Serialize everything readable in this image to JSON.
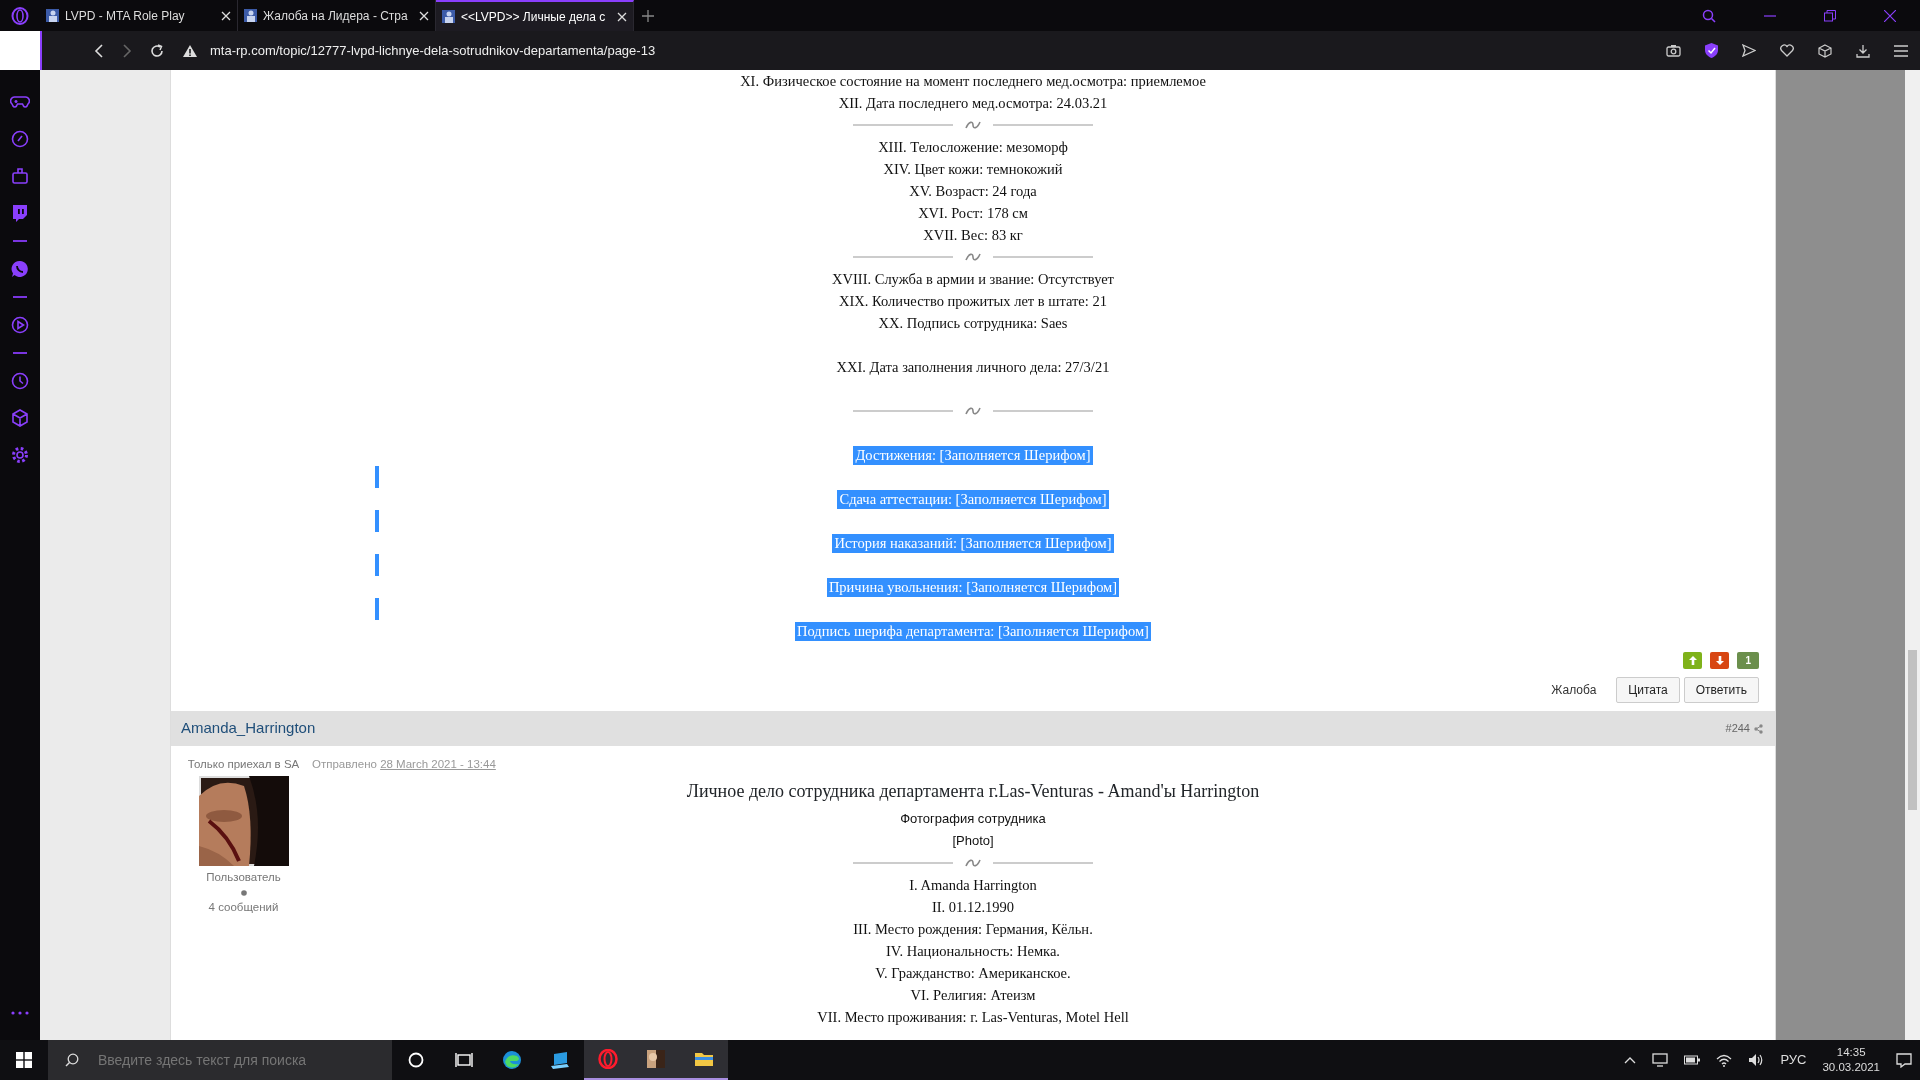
{
  "browser": {
    "tabs": [
      {
        "title": "LVPD - MTA Role Play",
        "selected": false
      },
      {
        "title": "Жалоба на Лидера - Стра",
        "selected": false
      },
      {
        "title": "<<LVPD>> Личные дела с",
        "selected": true
      }
    ],
    "url": "mta-rp.com/topic/12777-lvpd-lichnye-dela-sotrudnikov-departamenta/page-13"
  },
  "post1": {
    "lines": [
      {
        "kind": "text",
        "text": "XI. Физическое состояние на момент последнего мед.осмотра: приемлемое"
      },
      {
        "kind": "text",
        "text": "XII. Дата последнего мед.осмотра: 24.03.21"
      },
      {
        "kind": "divider"
      },
      {
        "kind": "text",
        "text": "XIII. Телосложение: мезоморф"
      },
      {
        "kind": "text",
        "text": "XIV. Цвет кожи: темнокожий"
      },
      {
        "kind": "text",
        "text": "XV. Возраст: 24 года"
      },
      {
        "kind": "text",
        "text": "XVI. Рост: 178 см"
      },
      {
        "kind": "text",
        "text": "XVII. Вес: 83 кг"
      },
      {
        "kind": "divider"
      },
      {
        "kind": "text",
        "text": "XVIII. Служба в армии и звание: Отсутствует"
      },
      {
        "kind": "text",
        "text": "XIX. Количество прожитых лет в штате: 21"
      },
      {
        "kind": "text",
        "text": "XX. Подпись сотрудника: Saes"
      },
      {
        "kind": "gap"
      },
      {
        "kind": "text",
        "text": "XXI. Дата заполнения личного дела: 27/3/21"
      },
      {
        "kind": "gap"
      },
      {
        "kind": "divider"
      },
      {
        "kind": "gap"
      },
      {
        "kind": "selected",
        "text": "Достижения: [Заполняется Шерифом]"
      },
      {
        "kind": "gap",
        "selected": true
      },
      {
        "kind": "selected",
        "text": "Сдача аттестации: [Заполняется Шерифом]"
      },
      {
        "kind": "gap",
        "selected": true
      },
      {
        "kind": "selected",
        "text": "История наказаний: [Заполняется Шерифом]"
      },
      {
        "kind": "gap",
        "selected": true
      },
      {
        "kind": "selected",
        "text": "Причина увольнения: [Заполняется Шерифом]"
      },
      {
        "kind": "gap",
        "selected": true
      },
      {
        "kind": "selected",
        "text": "Подпись шерифа департамента: [Заполняется Шерифом]"
      }
    ],
    "rating": "1",
    "actions": [
      "Жалоба",
      "Цитата",
      "Ответить"
    ]
  },
  "post2": {
    "author": "Amanda_Harrington",
    "number": "#244",
    "rank": "Только приехал в SA",
    "sent_label": "Отправлено",
    "date": "28 March 2021 - 13:44",
    "group": "Пользователь",
    "posts": "4 сообщений",
    "title": "Личное дело сотрудника департамента г.Las-Venturas - Amand'ы Harrington",
    "lines": [
      {
        "kind": "sans",
        "text": "Фотография сотрудника"
      },
      {
        "kind": "sans",
        "text": "[Photo]"
      },
      {
        "kind": "divider"
      },
      {
        "kind": "text",
        "text": "I.  Amanda Harrington"
      },
      {
        "kind": "text",
        "text": "II. 01.12.1990"
      },
      {
        "kind": "text",
        "text": "III. Место рождения:  Германия, Кёльн."
      },
      {
        "kind": "text",
        "text": "IV. Национальность:  Немка."
      },
      {
        "kind": "text",
        "text": "V. Гражданство:  Американское."
      },
      {
        "kind": "text",
        "text": "VI. Религия:  Атеизм"
      },
      {
        "kind": "text",
        "text": "VII. Место проживания: г. Las-Venturas, Motel Hell"
      }
    ]
  },
  "taskbar": {
    "search_placeholder": "Введите здесь текст для поиска",
    "language": "РУС",
    "time": "14:35",
    "date": "30.03.2021"
  }
}
